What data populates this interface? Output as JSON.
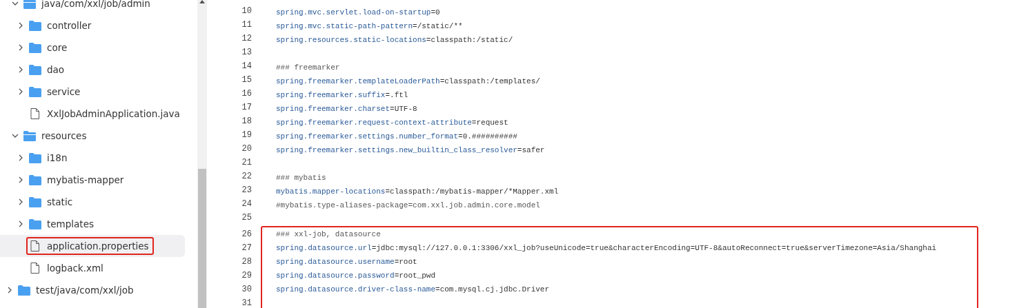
{
  "file_tree": [
    {
      "children": [
        {
          "label": "java/com/xxl/job/admin",
          "kind": "folder",
          "expanded": true,
          "selected": false,
          "highlighted": false,
          "children": [
            {
              "label": "controller",
              "kind": "folder",
              "expanded": false,
              "selected": false,
              "highlighted": false
            },
            {
              "label": "core",
              "kind": "folder",
              "expanded": false,
              "selected": false,
              "highlighted": false
            },
            {
              "label": "dao",
              "kind": "folder",
              "expanded": false,
              "selected": false,
              "highlighted": false
            },
            {
              "label": "service",
              "kind": "folder",
              "expanded": false,
              "selected": false,
              "highlighted": false
            },
            {
              "label": "XxlJobAdminApplication.java",
              "kind": "file",
              "selected": false,
              "highlighted": false
            }
          ]
        },
        {
          "label": "resources",
          "kind": "folder",
          "expanded": true,
          "selected": false,
          "highlighted": false,
          "children": [
            {
              "label": "i18n",
              "kind": "folder",
              "expanded": false,
              "selected": false,
              "highlighted": false
            },
            {
              "label": "mybatis-mapper",
              "kind": "folder",
              "expanded": false,
              "selected": false,
              "highlighted": false
            },
            {
              "label": "static",
              "kind": "folder",
              "expanded": false,
              "selected": false,
              "highlighted": false
            },
            {
              "label": "templates",
              "kind": "folder",
              "expanded": false,
              "selected": false,
              "highlighted": false
            },
            {
              "label": "application.properties",
              "kind": "file",
              "selected": true,
              "highlighted": true
            },
            {
              "label": "logback.xml",
              "kind": "file",
              "selected": false,
              "highlighted": false
            }
          ]
        }
      ]
    },
    {
      "label": "test/java/com/xxl/job",
      "kind": "folder",
      "expanded": false,
      "selected": false,
      "highlighted": false
    }
  ],
  "code_lines": [
    {
      "number": "10",
      "kind": "property",
      "key": "spring.mvc.servlet.load-on-startup",
      "value": "=0",
      "boxed": false
    },
    {
      "number": "11",
      "kind": "property",
      "key": "spring.mvc.static-path-pattern",
      "value": "=/static/**",
      "boxed": false
    },
    {
      "number": "12",
      "kind": "property",
      "key": "spring.resources.static-locations",
      "value": "=classpath:/static/",
      "boxed": false
    },
    {
      "number": "13",
      "kind": "blank",
      "boxed": false
    },
    {
      "number": "14",
      "kind": "comment",
      "text": "### freemarker",
      "boxed": false
    },
    {
      "number": "15",
      "kind": "property",
      "key": "spring.freemarker.templateLoaderPath",
      "value": "=classpath:/templates/",
      "boxed": false
    },
    {
      "number": "16",
      "kind": "property",
      "key": "spring.freemarker.suffix",
      "value": "=.ftl",
      "boxed": false
    },
    {
      "number": "17",
      "kind": "property",
      "key": "spring.freemarker.charset",
      "value": "=UTF-8",
      "boxed": false
    },
    {
      "number": "18",
      "kind": "property",
      "key": "spring.freemarker.request-context-attribute",
      "value": "=request",
      "boxed": false
    },
    {
      "number": "19",
      "kind": "property",
      "key": "spring.freemarker.settings.number_format",
      "value": "=0.##########",
      "boxed": false
    },
    {
      "number": "20",
      "kind": "property",
      "key": "spring.freemarker.settings.new_builtin_class_resolver",
      "value": "=safer",
      "boxed": false
    },
    {
      "number": "21",
      "kind": "blank",
      "boxed": false
    },
    {
      "number": "22",
      "kind": "comment",
      "text": "### mybatis",
      "boxed": false
    },
    {
      "number": "23",
      "kind": "property",
      "key": "mybatis.mapper-locations",
      "value": "=classpath:/mybatis-mapper/*Mapper.xml",
      "boxed": false
    },
    {
      "number": "24",
      "kind": "comment",
      "text": "#mybatis.type-aliases-package=com.xxl.job.admin.core.model",
      "boxed": false
    },
    {
      "number": "25",
      "kind": "blank",
      "boxed": false
    },
    {
      "number": "26",
      "kind": "comment",
      "text": "### xxl-job, datasource",
      "boxed": true
    },
    {
      "number": "27",
      "kind": "property",
      "key": "spring.datasource.url",
      "value": "=jdbc:mysql://127.0.0.1:3306/xxl_job?useUnicode=true&characterEncoding=UTF-8&autoReconnect=true&serverTimezone=Asia/Shanghai",
      "boxed": true
    },
    {
      "number": "28",
      "kind": "property",
      "key": "spring.datasource.username",
      "value": "=root",
      "boxed": true
    },
    {
      "number": "29",
      "kind": "property",
      "key": "spring.datasource.password",
      "value": "=root_pwd",
      "boxed": true
    },
    {
      "number": "30",
      "kind": "property",
      "key": "spring.datasource.driver-class-name",
      "value": "=com.mysql.cj.jdbc.Driver",
      "boxed": true
    },
    {
      "number": "31",
      "kind": "blank",
      "boxed": true
    }
  ]
}
